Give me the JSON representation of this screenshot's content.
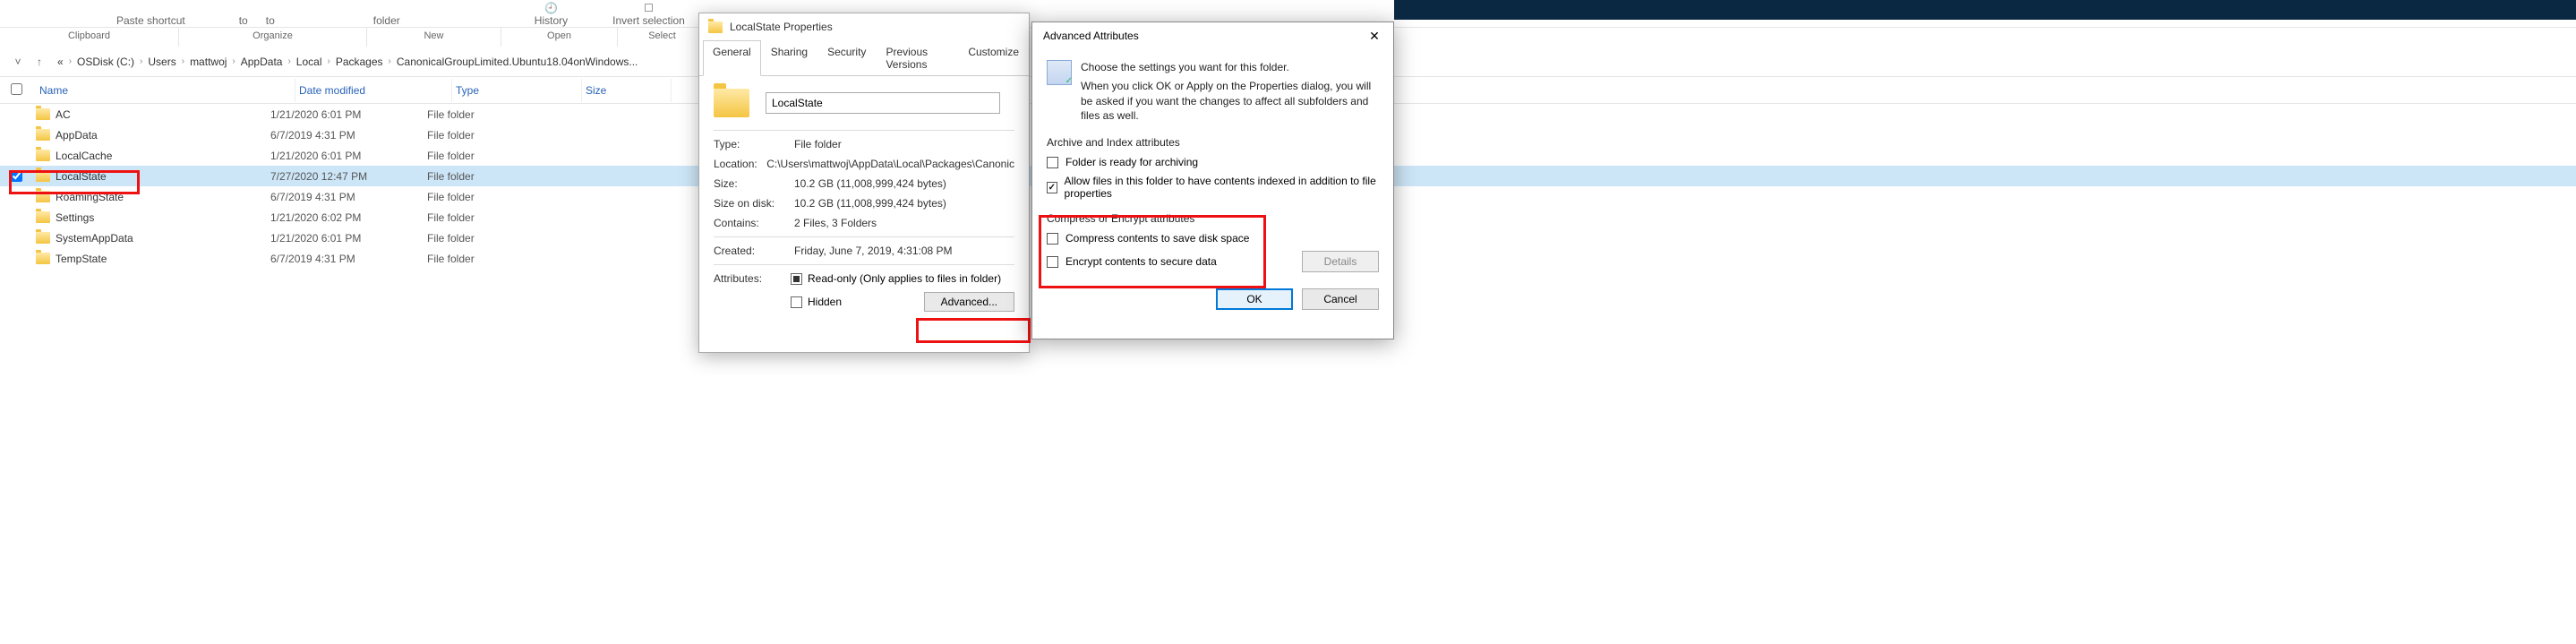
{
  "ribbon": {
    "paste_shortcut": "Paste shortcut",
    "move_to": "to",
    "copy_to": "to",
    "new_folder": "folder",
    "history": "History",
    "invert_selection": "Invert selection",
    "groups": {
      "clipboard": "Clipboard",
      "organize": "Organize",
      "new": "New",
      "open": "Open",
      "select": "Select"
    }
  },
  "breadcrumb": {
    "items": [
      "«",
      "OSDisk (C:)",
      "Users",
      "mattwoj",
      "AppData",
      "Local",
      "Packages",
      "CanonicalGroupLimited.Ubuntu18.04onWindows..."
    ]
  },
  "columns": {
    "name": "Name",
    "date": "Date modified",
    "type": "Type",
    "size": "Size"
  },
  "files": [
    {
      "name": "AC",
      "date": "1/21/2020 6:01 PM",
      "type": "File folder",
      "selected": false,
      "checked": false
    },
    {
      "name": "AppData",
      "date": "6/7/2019 4:31 PM",
      "type": "File folder",
      "selected": false,
      "checked": false
    },
    {
      "name": "LocalCache",
      "date": "1/21/2020 6:01 PM",
      "type": "File folder",
      "selected": false,
      "checked": false
    },
    {
      "name": "LocalState",
      "date": "7/27/2020 12:47 PM",
      "type": "File folder",
      "selected": true,
      "checked": true
    },
    {
      "name": "RoamingState",
      "date": "6/7/2019 4:31 PM",
      "type": "File folder",
      "selected": false,
      "checked": false
    },
    {
      "name": "Settings",
      "date": "1/21/2020 6:02 PM",
      "type": "File folder",
      "selected": false,
      "checked": false
    },
    {
      "name": "SystemAppData",
      "date": "1/21/2020 6:01 PM",
      "type": "File folder",
      "selected": false,
      "checked": false
    },
    {
      "name": "TempState",
      "date": "6/7/2019 4:31 PM",
      "type": "File folder",
      "selected": false,
      "checked": false
    }
  ],
  "properties": {
    "title": "LocalState Properties",
    "tabs": [
      "General",
      "Sharing",
      "Security",
      "Previous Versions",
      "Customize"
    ],
    "name_value": "LocalState",
    "rows": {
      "type_label": "Type:",
      "type_val": "File folder",
      "location_label": "Location:",
      "location_val": "C:\\Users\\mattwoj\\AppData\\Local\\Packages\\Canonic",
      "size_label": "Size:",
      "size_val": "10.2 GB (11,008,999,424 bytes)",
      "disk_label": "Size on disk:",
      "disk_val": "10.2 GB (11,008,999,424 bytes)",
      "contains_label": "Contains:",
      "contains_val": "2 Files, 3 Folders",
      "created_label": "Created:",
      "created_val": "Friday, June 7, 2019, 4:31:08 PM",
      "attr_label": "Attributes:",
      "readonly_label": "Read-only (Only applies to files in folder)",
      "hidden_label": "Hidden",
      "advanced_btn": "Advanced..."
    }
  },
  "advanced": {
    "title": "Advanced Attributes",
    "desc1": "Choose the settings you want for this folder.",
    "desc2": "When you click OK or Apply on the Properties dialog, you will be asked if you want the changes to affect all subfolders and files as well.",
    "archive_section": "Archive and Index attributes",
    "archive_ready": "Folder is ready for archiving",
    "allow_index": "Allow files in this folder to have contents indexed in addition to file properties",
    "compress_section": "Compress or Encrypt attributes",
    "compress": "Compress contents to save disk space",
    "encrypt": "Encrypt contents to secure data",
    "details_btn": "Details",
    "ok_btn": "OK",
    "cancel_btn": "Cancel"
  }
}
